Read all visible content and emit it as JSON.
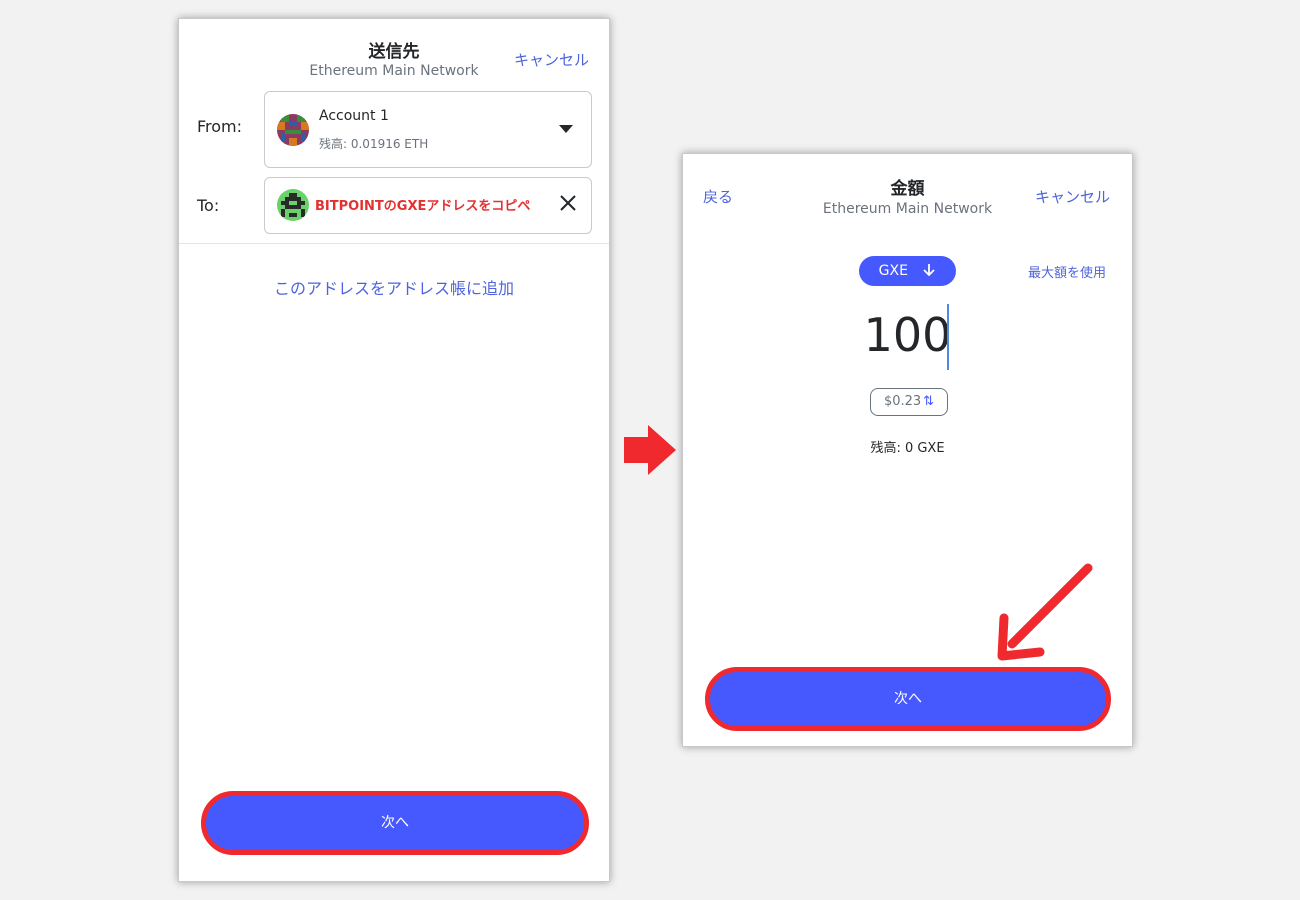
{
  "left": {
    "title": "送信先",
    "network": "Ethereum Main Network",
    "cancel_label": "キャンセル",
    "from_label": "From:",
    "account_name": "Account 1",
    "account_balance": "残高: 0.01916 ETH",
    "to_label": "To:",
    "to_value": "BITPOINTのGXEアドレスをコピペ",
    "add_address_label": "このアドレスをアドレス帳に追加",
    "next_label": "次へ"
  },
  "right": {
    "title": "金額",
    "network": "Ethereum Main Network",
    "back_label": "戻る",
    "cancel_label": "キャンセル",
    "token_label": "GXE",
    "max_label": "最大額を使用",
    "amount": "100",
    "fiat_value": "$0.23",
    "balance": "残高: 0 GXE",
    "next_label": "次へ"
  },
  "colors": {
    "accent": "#4659ff",
    "link": "#4e64dc",
    "highlight_red": "#f0292e"
  },
  "icons": [
    "caret-down-icon",
    "close-icon",
    "arrow-down-icon",
    "swap-icon",
    "right-arrow-icon",
    "diagonal-arrow-icon"
  ]
}
